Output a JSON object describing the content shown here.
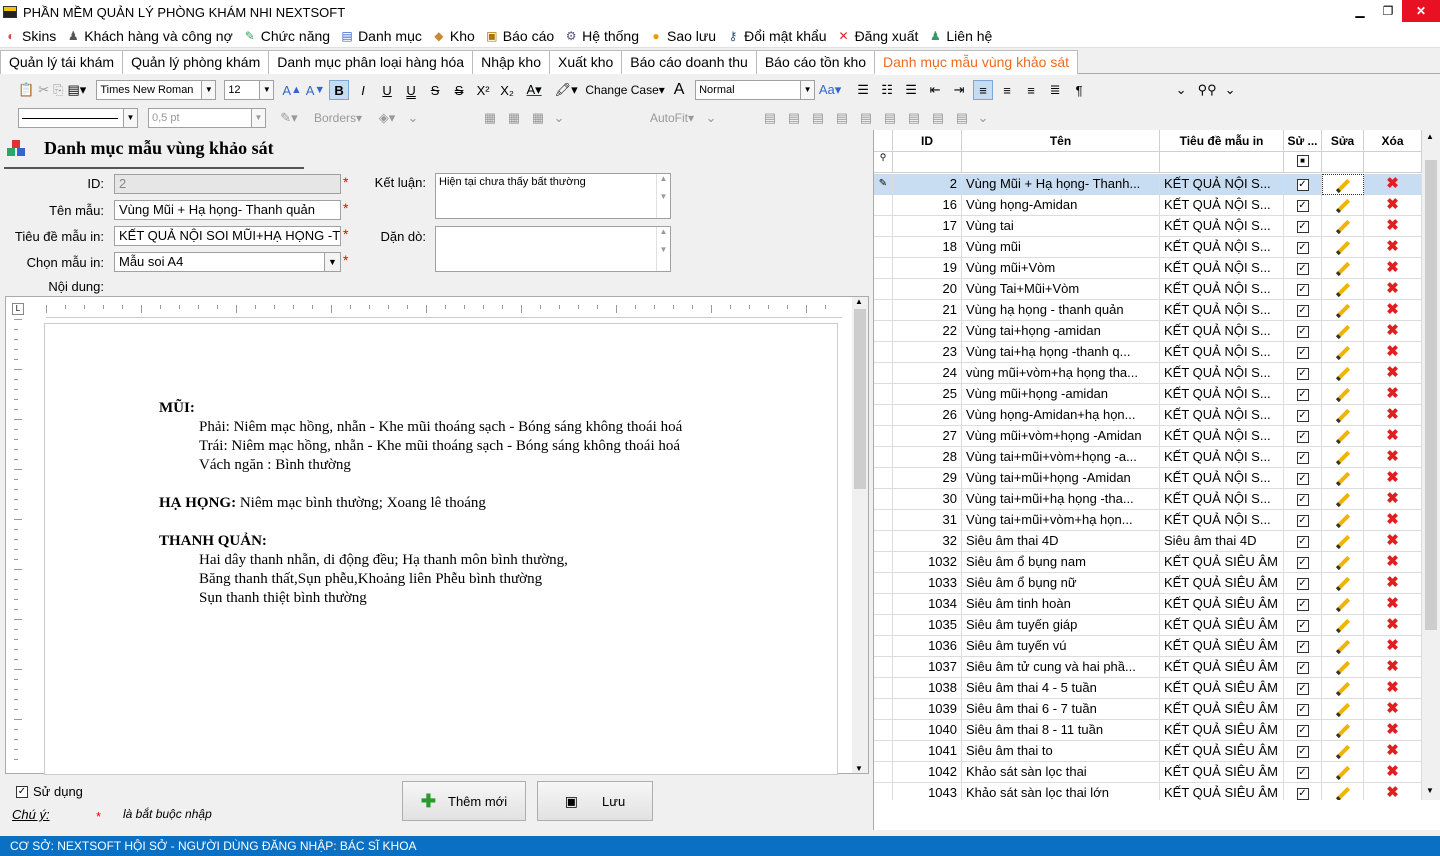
{
  "app": {
    "title": "PHẦN MỀM QUẢN LÝ PHÒNG KHÁM NHI NEXTSOFT"
  },
  "menu": [
    {
      "icon": "skins-icon",
      "glyph": "◐",
      "label": "Skins",
      "color": "#d44"
    },
    {
      "icon": "customer-icon",
      "glyph": "♟",
      "label": "Khách hàng và công nợ",
      "color": "#555"
    },
    {
      "icon": "function-icon",
      "glyph": "✎",
      "label": "Chức năng",
      "color": "#2a6"
    },
    {
      "icon": "catalog-icon",
      "glyph": "▤",
      "label": "Danh mục",
      "color": "#36c"
    },
    {
      "icon": "warehouse-icon",
      "glyph": "◆",
      "label": "Kho",
      "color": "#c83"
    },
    {
      "icon": "report-icon",
      "glyph": "▣",
      "label": "Báo cáo",
      "color": "#a70"
    },
    {
      "icon": "system-icon",
      "glyph": "⚙",
      "label": "Hệ thống",
      "color": "#557"
    },
    {
      "icon": "backup-icon",
      "glyph": "●",
      "label": "Sao lưu",
      "color": "#e90"
    },
    {
      "icon": "key-icon",
      "glyph": "⚷",
      "label": "Đổi mật khẩu",
      "color": "#357"
    },
    {
      "icon": "logout-icon",
      "glyph": "✕",
      "label": "Đăng xuất",
      "color": "#d22"
    },
    {
      "icon": "contact-icon",
      "glyph": "♟",
      "label": "Liên hệ",
      "color": "#396"
    }
  ],
  "tabs": [
    "Quản lý tái khám",
    "Quản lý phòng khám",
    "Danh mục phân loại hàng hóa",
    "Nhập kho",
    "Xuất kho",
    "Báo cáo doanh thu",
    "Báo cáo tồn kho",
    "Danh mục mẫu vùng khảo sát"
  ],
  "toolbar": {
    "font": "Times New Roman",
    "size": "12",
    "change_case": "Change Case",
    "style": "Normal",
    "line_width": "0,5 pt",
    "borders": "Borders",
    "autofit": "AutoFit"
  },
  "form": {
    "title": "Danh mục mẫu vùng khảo sát",
    "id_label": "ID:",
    "id_value": "2",
    "name_label": "Tên mẫu:",
    "name_value": "Vùng Mũi + Hạ họng- Thanh quản",
    "print_title_label": "Tiêu đề mẫu in:",
    "print_title_value": "KẾT QUẢ NỘI SOI MŨI+HẠ HỌNG -T",
    "template_label": "Chọn mẫu in:",
    "template_value": "Mẫu soi A4",
    "conclusion_label": "Kết luận:",
    "conclusion_value": "Hiện tại chưa thấy bất thường",
    "advice_label": "Dặn dò:",
    "advice_value": "",
    "content_label": "Nội dung:",
    "use_label": "Sử dụng",
    "note_label": "Chú ý:",
    "note_star": "*",
    "note_text": "là bắt buộc nhập",
    "add_button": "Thêm mới",
    "save_button": "Lưu"
  },
  "document": {
    "lines": [
      {
        "bold": "MŨI:",
        "text": "",
        "indent": 0
      },
      {
        "bold": "",
        "text": "Phải: Niêm mạc hồng, nhẵn - Khe mũi thoáng sạch - Bóng sáng không thoái hoá",
        "indent": 1
      },
      {
        "bold": "",
        "text": "Trái:  Niêm mạc hồng, nhẵn - Khe mũi thoáng sạch - Bóng sáng không thoái hoá",
        "indent": 1
      },
      {
        "bold": "",
        "text": "Vách ngăn : Bình thường",
        "indent": 1
      },
      {
        "bold": "",
        "text": "",
        "indent": 0
      },
      {
        "bold": "HẠ HỌNG:",
        "text": " Niêm mạc bình thường; Xoang lê thoáng",
        "indent": 0
      },
      {
        "bold": "",
        "text": "",
        "indent": 0
      },
      {
        "bold": "THANH QUẢN:",
        "text": "",
        "indent": 0
      },
      {
        "bold": "",
        "text": "Hai dây thanh nhẵn, di động đều; Hạ thanh môn bình thường,",
        "indent": 1
      },
      {
        "bold": "",
        "text": "Băng thanh thất,Sụn phễu,Khoảng liên Phễu bình thường",
        "indent": 1
      },
      {
        "bold": "",
        "text": "Sụn thanh thiệt bình thường",
        "indent": 1
      }
    ]
  },
  "grid": {
    "headers": [
      "ID",
      "Tên",
      "Tiêu đề mẫu in",
      "Sử ...",
      "Sửa",
      "Xóa"
    ],
    "rows": [
      [
        "2",
        "Vùng Mũi + Hạ họng- Thanh...",
        "KẾT QUẢ NỘI S..."
      ],
      [
        "16",
        "Vùng họng-Amidan",
        "KẾT QUẢ NỘI S..."
      ],
      [
        "17",
        "Vùng tai",
        "KẾT QUẢ NỘI S..."
      ],
      [
        "18",
        "Vùng mũi",
        "KẾT QUẢ NỘI S..."
      ],
      [
        "19",
        "Vùng mũi+Vòm",
        "KẾT QUẢ NỘI S..."
      ],
      [
        "20",
        "Vùng Tai+Mũi+Vòm",
        "KẾT QUẢ NỘI S..."
      ],
      [
        "21",
        "Vùng hạ họng - thanh quản",
        "KẾT QUẢ NỘI S..."
      ],
      [
        "22",
        "Vùng tai+họng -amidan",
        "KẾT QUẢ NỘI S..."
      ],
      [
        "23",
        "Vùng tai+hạ họng -thanh q...",
        "KẾT QUẢ NỘI S..."
      ],
      [
        "24",
        "vùng mũi+vòm+hạ họng tha...",
        "KẾT QUẢ NỘI S..."
      ],
      [
        "25",
        "Vùng mũi+họng -amidan",
        "KẾT QUẢ NỘI S..."
      ],
      [
        "26",
        "Vùng họng-Amidan+hạ họn...",
        "KẾT QUẢ NỘI S..."
      ],
      [
        "27",
        "Vùng mũi+vòm+họng -Amidan",
        "KẾT QUẢ NỘI S..."
      ],
      [
        "28",
        "Vùng tai+mũi+vòm+họng -a...",
        "KẾT QUẢ NỘI S..."
      ],
      [
        "29",
        "Vùng tai+mũi+họng -Amidan",
        "KẾT QUẢ NỘI S..."
      ],
      [
        "30",
        "Vùng tai+mũi+hạ họng -tha...",
        "KẾT QUẢ NỘI S..."
      ],
      [
        "31",
        "Vùng tai+mũi+vòm+hạ họn...",
        "KẾT QUẢ NỘI S..."
      ],
      [
        "32",
        "Siêu âm thai 4D",
        "Siêu âm thai 4D"
      ],
      [
        "1032",
        "Siêu âm ổ bụng nam",
        "KẾT QUẢ SIÊU ÂM"
      ],
      [
        "1033",
        "Siêu âm ổ bụng nữ",
        "KẾT QUẢ SIÊU ÂM"
      ],
      [
        "1034",
        "Siêu âm tinh hoàn",
        "KẾT QUẢ SIÊU ÂM"
      ],
      [
        "1035",
        "Siêu âm tuyến giáp",
        "KẾT QUẢ SIÊU ÂM"
      ],
      [
        "1036",
        "Siêu âm tuyến vú",
        "KẾT QUẢ SIÊU ÂM"
      ],
      [
        "1037",
        "Siêu âm tử cung và hai phầ...",
        "KẾT QUẢ SIÊU ÂM"
      ],
      [
        "1038",
        "Siêu âm thai 4 - 5 tuần",
        "KẾT QUẢ SIÊU ÂM"
      ],
      [
        "1039",
        "Siêu âm thai 6 - 7 tuần",
        "KẾT QUẢ SIÊU ÂM"
      ],
      [
        "1040",
        "Siêu âm thai 8 - 11 tuần",
        "KẾT QUẢ SIÊU ÂM"
      ],
      [
        "1041",
        "Siêu âm thai to",
        "KẾT QUẢ SIÊU ÂM"
      ],
      [
        "1042",
        "Khảo sát sàn lọc thai",
        "KẾT QUẢ SIÊU ÂM"
      ],
      [
        "1043",
        "Khảo sát sàn lọc thai lớn",
        "KẾT QUẢ SIÊU ÂM"
      ]
    ]
  },
  "status": {
    "text": "CƠ SỞ: NEXTSOFT HỘI SỞ - NGƯỜI DÙNG ĐĂNG NHẬP: BÁC SĨ KHOA"
  }
}
